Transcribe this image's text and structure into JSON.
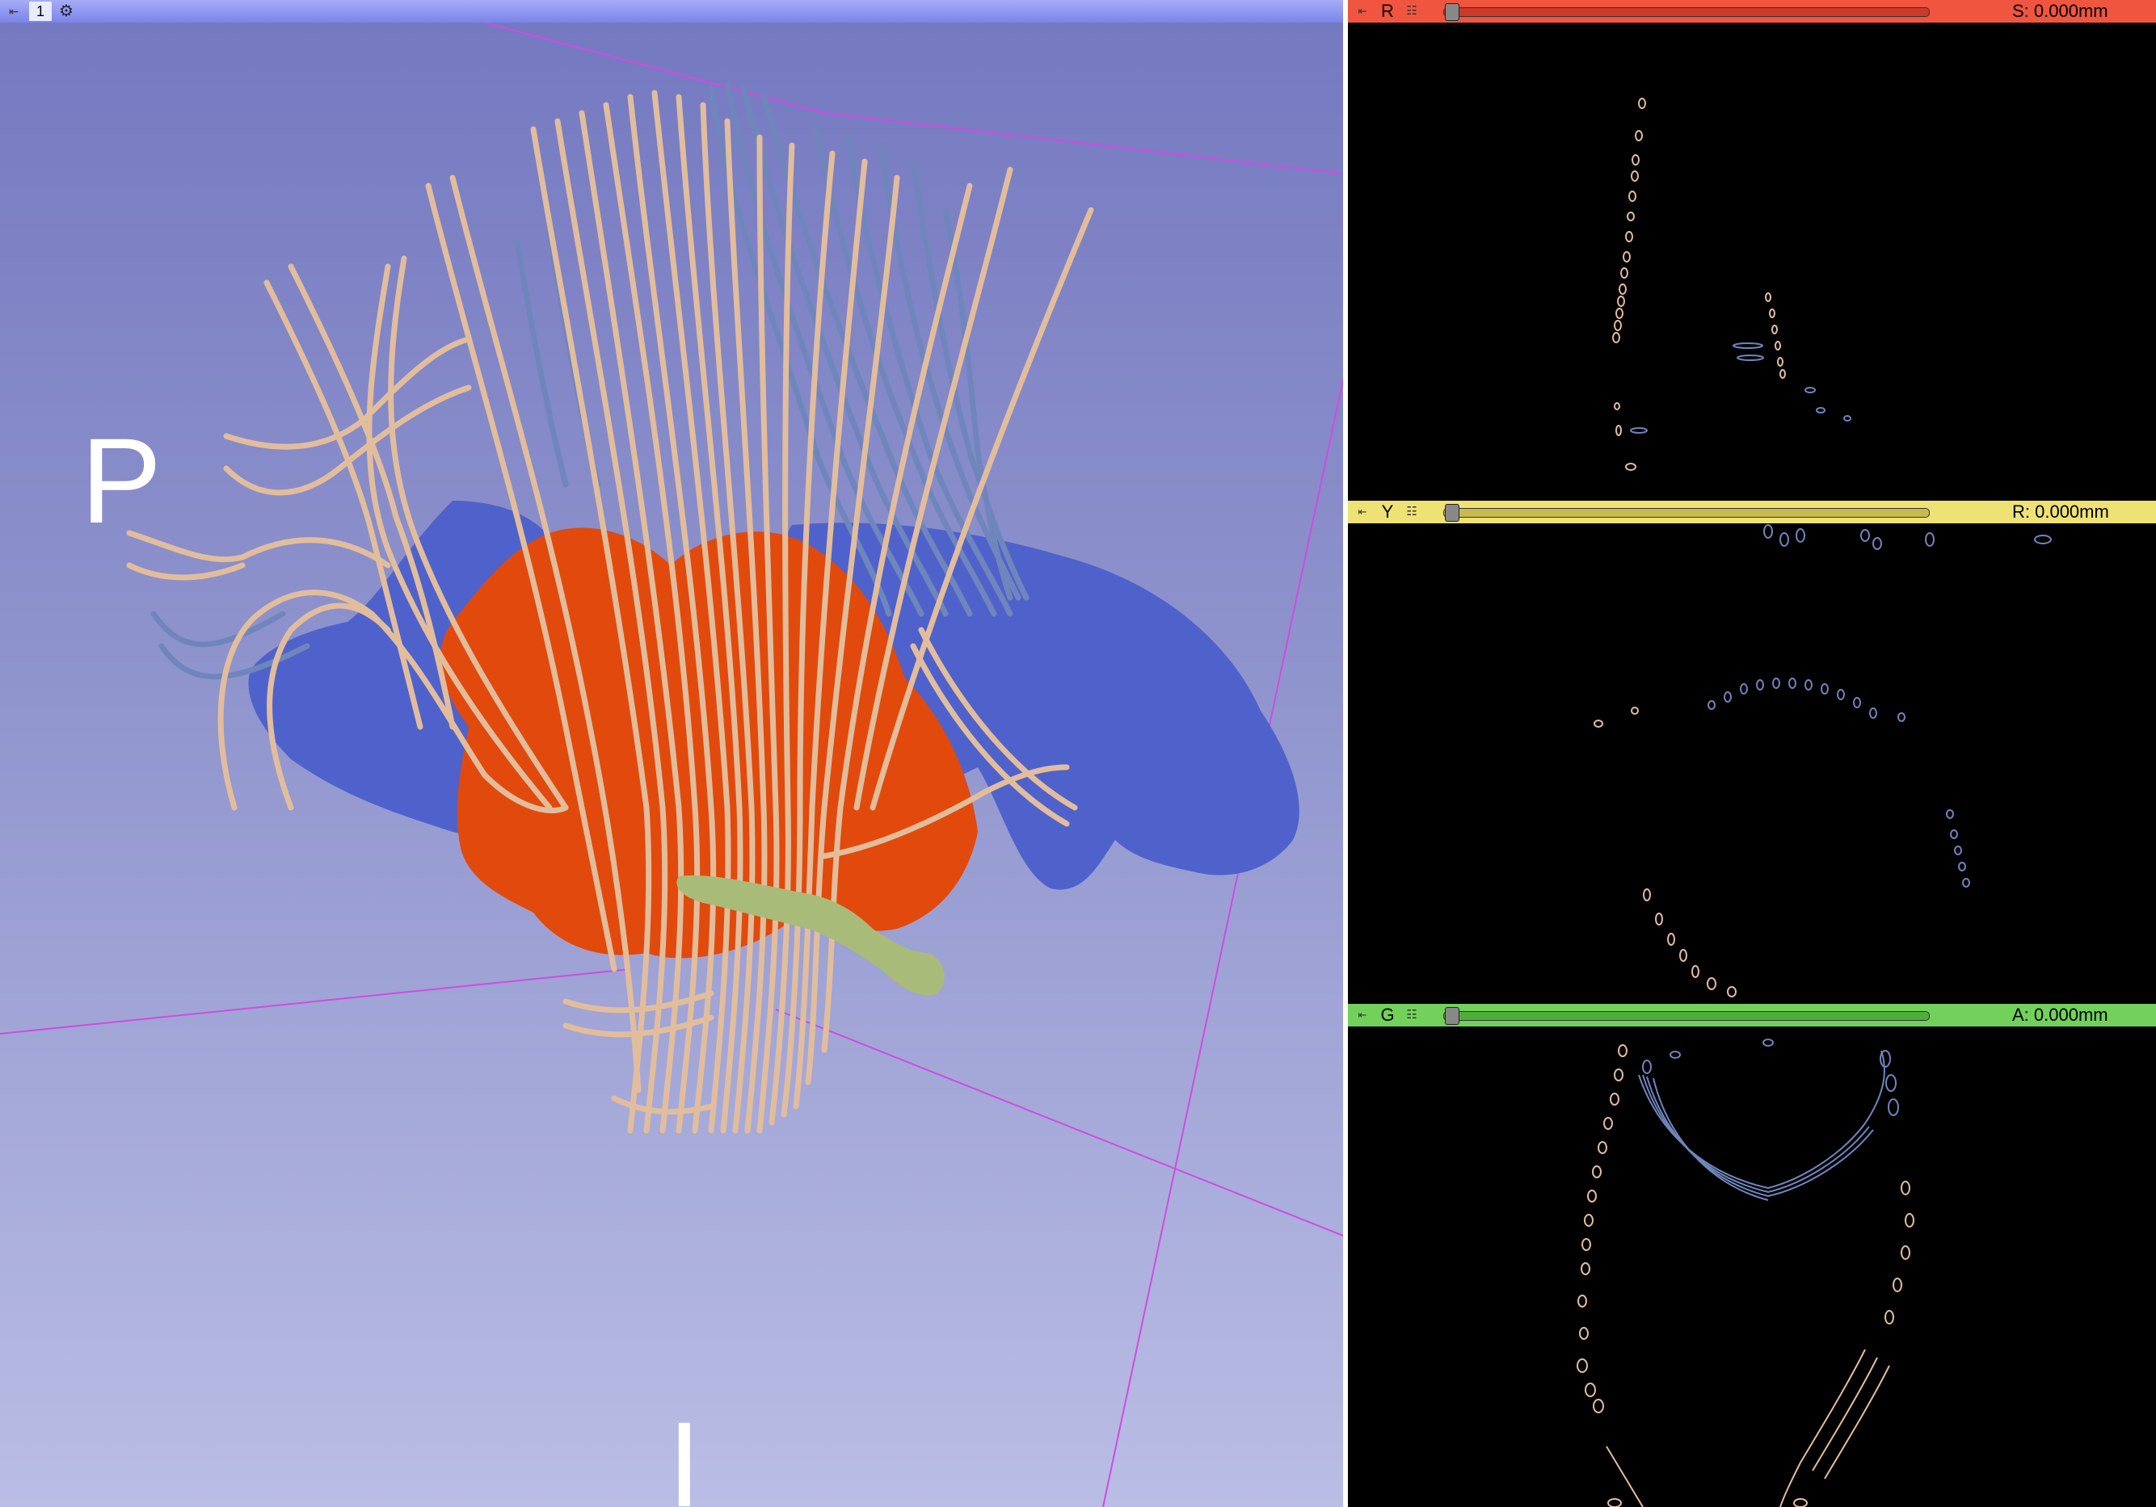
{
  "view3d": {
    "view_number": "1",
    "pin_icon": "pin-icon",
    "gear_icon": "gear-icon",
    "orientation_left": "P",
    "orientation_bottom": "I",
    "background_top": "#7478c0",
    "background_bottom": "#babde4",
    "colors": {
      "fiber_bundle": "#e2bd9c",
      "fiber_bundle_blue": "#6f86bd",
      "orange_structure": "#e14a0c",
      "blue_structure": "#4f62cc",
      "green_structure": "#a9bb78",
      "bounding_lines": "#d04be0"
    }
  },
  "slices": [
    {
      "id": "red",
      "letter": "R",
      "offset": "S: 0.000mm",
      "color": "#f05540",
      "track": "#cc3a2a"
    },
    {
      "id": "yellow",
      "letter": "Y",
      "offset": "R: 0.000mm",
      "color": "#efe275",
      "track": "#c8b94e"
    },
    {
      "id": "green",
      "letter": "G",
      "offset": "A: 0.000mm",
      "color": "#72d15a",
      "track": "#4fae3a"
    }
  ]
}
